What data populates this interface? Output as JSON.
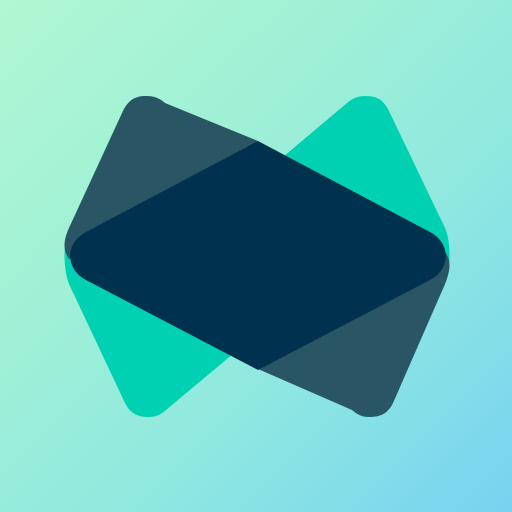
{
  "app_icon": {
    "name": "bowtie-logo-icon",
    "colors": {
      "background_start": "#b1f7d3",
      "background_end": "#77d2f2",
      "teal": "#00d1b2",
      "navy": "#00314f",
      "slate_overlay": "#2a5565"
    }
  }
}
